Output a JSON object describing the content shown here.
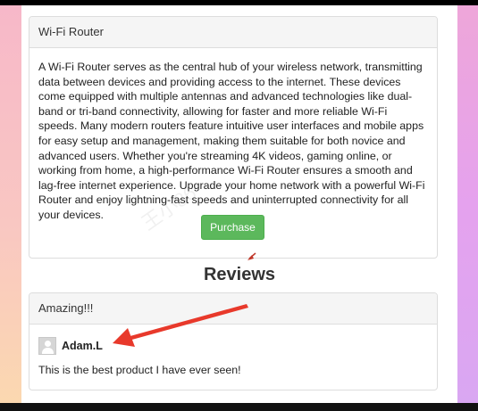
{
  "product": {
    "title": "Wi-Fi Router",
    "description": "A Wi-Fi Router serves as the central hub of your wireless network, transmitting data between devices and providing access to the internet. These devices come equipped with multiple antennas and advanced technologies like dual-band or tri-band connectivity, allowing for faster and more reliable Wi-Fi speeds. Many modern routers feature intuitive user interfaces and mobile apps for easy setup and management, making them suitable for both novice and advanced users. Whether you're streaming 4K videos, gaming online, or working from home, a high-performance Wi-Fi Router ensures a smooth and lag-free internet experience. Upgrade your home network with a powerful Wi-Fi Router and enjoy lightning-fast speeds and uninterrupted connectivity for all your devices.",
    "purchase_label": "Purchase"
  },
  "reviews": {
    "heading": "Reviews",
    "items": [
      {
        "title": "Amazing!!!",
        "author": "Adam.L",
        "text": "This is the best product I have ever seen!"
      }
    ]
  },
  "colors": {
    "purchase_button": "#5cb85c",
    "annotation_arrow": "#e8392b",
    "panel_heading_bg": "#f5f5f5"
  },
  "watermark_text": "王小86"
}
